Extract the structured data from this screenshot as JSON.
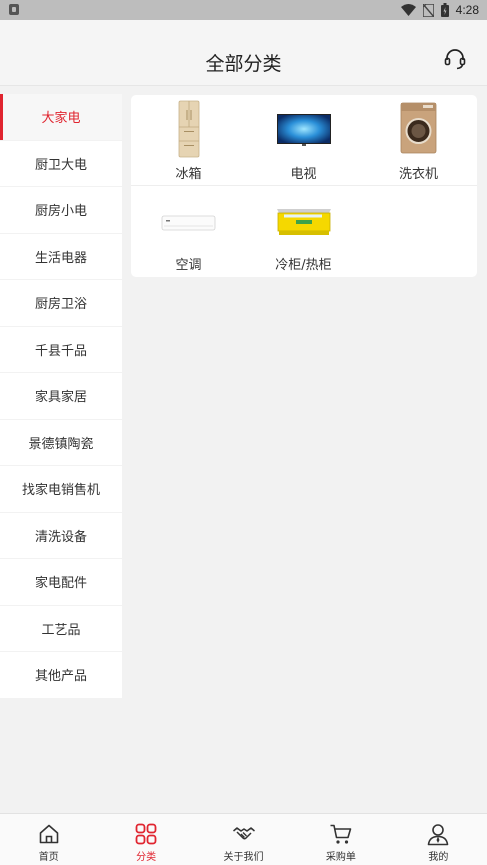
{
  "status_bar": {
    "time": "4:28"
  },
  "header": {
    "title": "全部分类",
    "service_icon": "headset-icon"
  },
  "sidebar": {
    "items": [
      {
        "label": "大家电",
        "active": true
      },
      {
        "label": "厨卫大电"
      },
      {
        "label": "厨房小电"
      },
      {
        "label": "生活电器"
      },
      {
        "label": "厨房卫浴"
      },
      {
        "label": "千县千品"
      },
      {
        "label": "家具家居"
      },
      {
        "label": "景德镇陶瓷"
      },
      {
        "label": "找家电销售机"
      },
      {
        "label": "清洗设备"
      },
      {
        "label": "家电配件"
      },
      {
        "label": "工艺品"
      },
      {
        "label": "其他产品"
      }
    ]
  },
  "categories": [
    {
      "label": "冰箱",
      "icon": "refrigerator-icon"
    },
    {
      "label": "电视",
      "icon": "tv-icon"
    },
    {
      "label": "洗衣机",
      "icon": "washing-machine-icon"
    },
    {
      "label": "空调",
      "icon": "air-conditioner-icon"
    },
    {
      "label": "冷柜/热柜",
      "icon": "freezer-icon"
    }
  ],
  "tabbar": {
    "items": [
      {
        "label": "首页",
        "icon": "home-icon"
      },
      {
        "label": "分类",
        "icon": "grid-icon",
        "active": true
      },
      {
        "label": "关于我们",
        "icon": "handshake-icon"
      },
      {
        "label": "采购单",
        "icon": "cart-icon"
      },
      {
        "label": "我的",
        "icon": "user-icon"
      }
    ]
  },
  "colors": {
    "accent": "#e0242f",
    "background": "#f2f2f2"
  }
}
